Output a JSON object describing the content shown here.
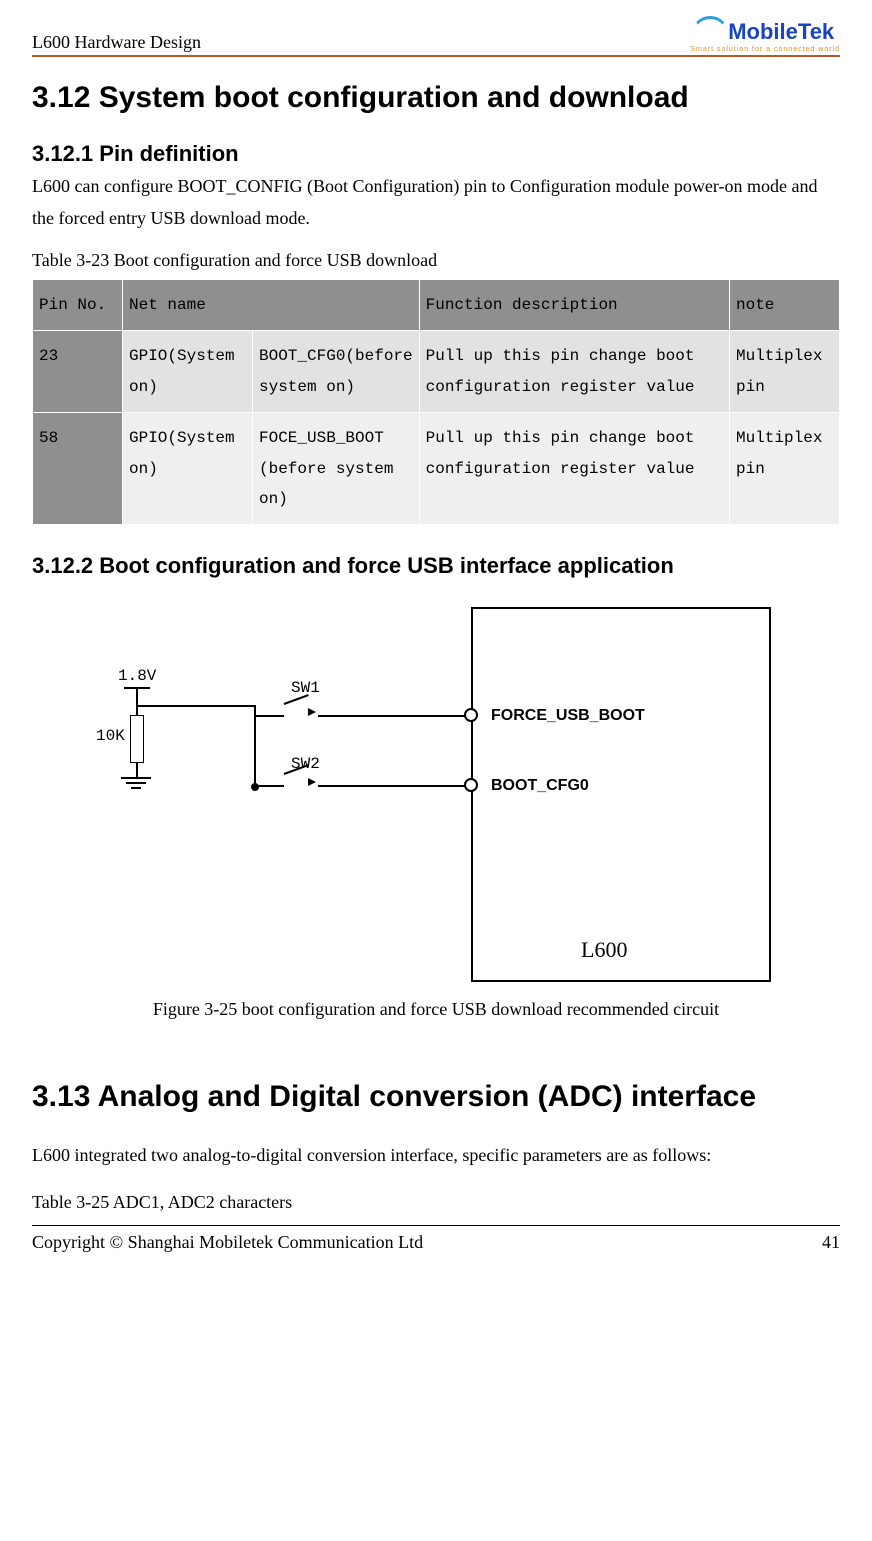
{
  "header": {
    "title": "L600 Hardware Design",
    "logo_name": "MobileTek",
    "logo_tagline": "Smart solution for a connected world"
  },
  "sections": {
    "s1": {
      "title": "3.12 System boot configuration and download"
    },
    "s1_1": {
      "title": "3.12.1 Pin definition",
      "body": "L600 can configure BOOT_CONFIG (Boot Configuration) pin to Configuration module power-on mode and the forced entry USB download mode."
    },
    "table323": {
      "caption": "Table 3-23 Boot configuration and force USB download",
      "headers": {
        "pin": "Pin No.",
        "net": "Net name",
        "func": "Function description",
        "note": "note"
      },
      "rows": [
        {
          "pin": "23",
          "net1": "GPIO(System on)",
          "net2": "BOOT_CFG0(before system on)",
          "func": "Pull up this pin change boot configuration register value",
          "note": "Multiplex pin"
        },
        {
          "pin": "58",
          "net1": "GPIO(System on)",
          "net2": "FOCE_USB_BOOT (before system on)",
          "func": "Pull up this pin change boot configuration register value",
          "note": "Multiplex pin"
        }
      ]
    },
    "s1_2": {
      "title": "3.12.2 Boot configuration and force USB interface application"
    },
    "diagram": {
      "v18": "1.8V",
      "r": "10K",
      "sw1": "SW1",
      "sw2": "SW2",
      "pin1": "FORCE_USB_BOOT",
      "pin2": "BOOT_CFG0",
      "chip": "L600"
    },
    "figure_caption": "Figure 3-25 boot configuration and force USB download recommended circuit",
    "s2": {
      "title": "3.13 Analog and Digital conversion (ADC) interface",
      "body": "L600 integrated two analog-to-digital conversion interface, specific parameters are as follows:"
    },
    "table325_caption": "Table 3-25 ADC1, ADC2 characters"
  },
  "footer": {
    "left": "Copyright © Shanghai Mobiletek Communication Ltd",
    "right": "41"
  }
}
